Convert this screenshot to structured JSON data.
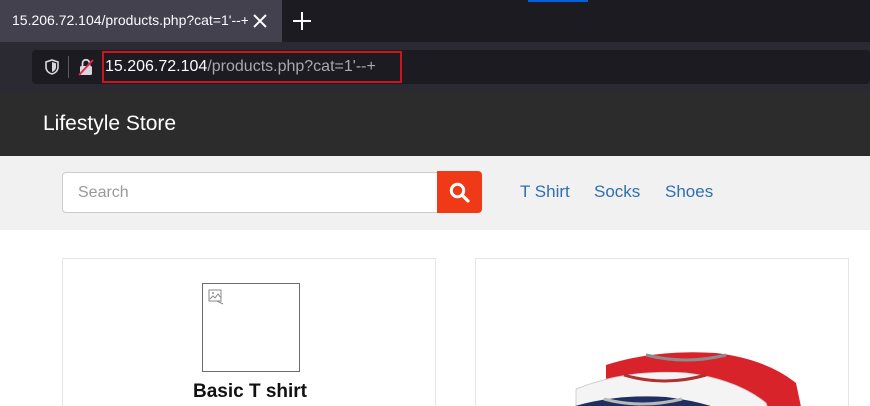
{
  "browser": {
    "tab": {
      "title": "15.206.72.104/products.php?cat=1'--+",
      "close_icon": "close-icon"
    },
    "new_tab_icon": "plus-icon",
    "url": {
      "host": "15.206.72.104",
      "path": "/products.php?cat=1'--+",
      "shield_icon": "shield-icon",
      "lock_icon": "insecure-lock-icon",
      "highlight_color": "#d0141e"
    }
  },
  "site": {
    "brand": "Lifestyle Store",
    "search": {
      "placeholder": "Search",
      "value": "",
      "button_icon": "search-icon",
      "button_color": "#f03a17"
    },
    "categories": [
      "T Shirt",
      "Socks",
      "Shoes"
    ],
    "link_color": "#2f6fb0",
    "products": [
      {
        "name": "Basic T shirt",
        "image": "broken-image-icon"
      },
      {
        "name": "",
        "image": "tshirts-image"
      }
    ]
  }
}
